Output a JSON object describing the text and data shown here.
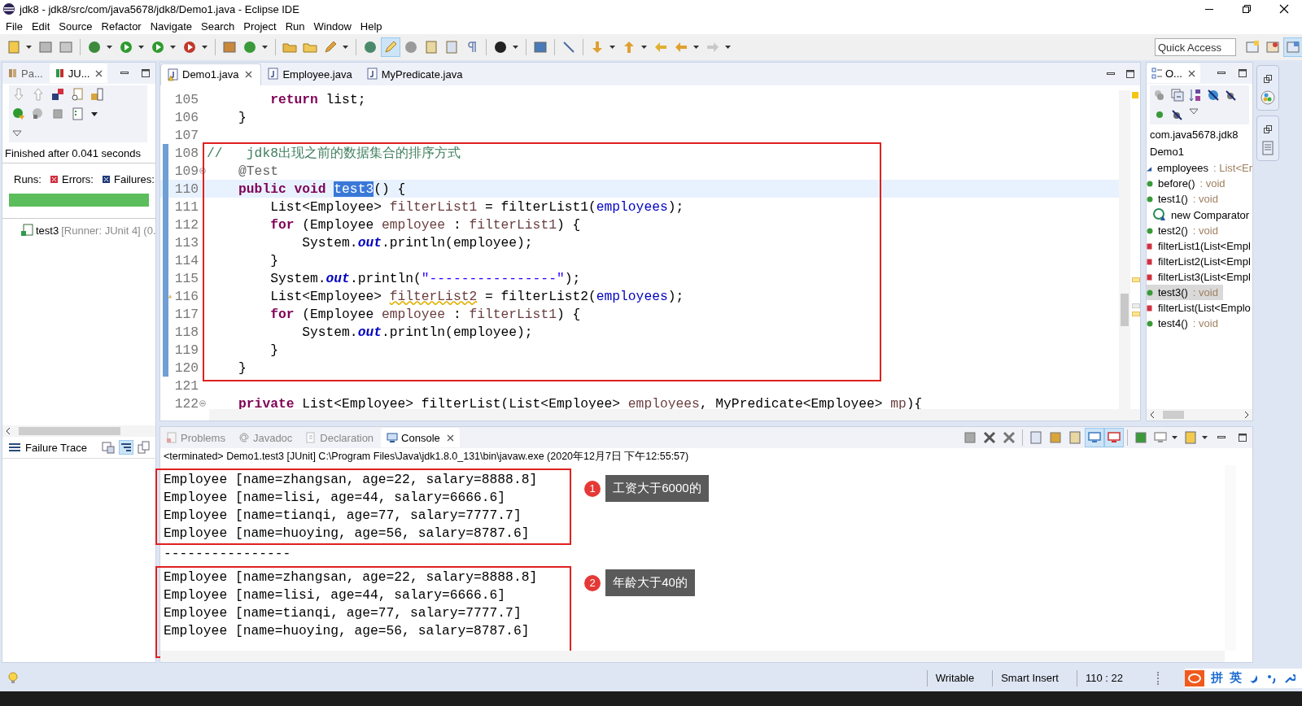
{
  "window": {
    "title": "jdk8 - jdk8/src/com/java5678/jdk8/Demo1.java - Eclipse IDE"
  },
  "menu": [
    "File",
    "Edit",
    "Source",
    "Refactor",
    "Navigate",
    "Search",
    "Project",
    "Run",
    "Window",
    "Help"
  ],
  "quick_access": {
    "placeholder": "Quick Access"
  },
  "junit": {
    "tabs": [
      {
        "label": "Pa...",
        "selected": false
      },
      {
        "label": "JU...",
        "selected": true
      }
    ],
    "status": "Finished after 0.041 seconds",
    "runs": "Runs:",
    "errors": "Errors:",
    "failures": "Failures:",
    "level": 1,
    "tree": [
      {
        "name": "test3",
        "detail": "[Runner: JUnit 4] (0."
      }
    ],
    "failure_trace": "Failure Trace"
  },
  "editor": {
    "tabs": [
      {
        "label": "Demo1.java",
        "selected": true,
        "warning": true
      },
      {
        "label": "Employee.java",
        "selected": false,
        "warning": false
      },
      {
        "label": "MyPredicate.java",
        "selected": false,
        "warning": false
      }
    ],
    "blocks": [
      {
        "boxed": false,
        "lines": [
          {
            "number": "105",
            "changed": false,
            "current": false,
            "fold": false,
            "warning": false,
            "tokens": [
              {
                "text": "        return",
                "kind": "keyword"
              },
              {
                "text": " list;",
                "kind": "plain"
              }
            ]
          },
          {
            "number": "106",
            "changed": false,
            "current": false,
            "fold": false,
            "warning": false,
            "tokens": [
              {
                "text": "    }",
                "kind": "plain"
              }
            ]
          },
          {
            "number": "107",
            "changed": false,
            "current": false,
            "fold": false,
            "warning": false
          }
        ]
      },
      {
        "boxed": true,
        "lines": [
          {
            "number": "108",
            "changed": true,
            "current": false,
            "fold": false,
            "warning": false,
            "tokens": [
              {
                "text": "//   jdk8出现之前的数据集合的排序方式",
                "kind": "comment"
              }
            ]
          },
          {
            "number": "109",
            "changed": true,
            "current": false,
            "fold": true,
            "warning": false,
            "tokens": [
              {
                "text": "    @Test",
                "kind": "annotation"
              }
            ]
          },
          {
            "number": "110",
            "changed": true,
            "current": true,
            "fold": false,
            "warning": false,
            "tokens": [
              {
                "text": "    public void ",
                "kind": "keyword"
              },
              {
                "text": "test3",
                "kind": "selection"
              },
              {
                "text": "() {",
                "kind": "plain"
              }
            ]
          },
          {
            "number": "111",
            "changed": true,
            "current": false,
            "fold": false,
            "warning": false,
            "tokens": [
              {
                "text": "        List<Employee> ",
                "kind": "plain"
              },
              {
                "text": "filterList1",
                "kind": "local"
              },
              {
                "text": " = filterList1(",
                "kind": "plain"
              },
              {
                "text": "employees",
                "kind": "field"
              },
              {
                "text": ");",
                "kind": "plain"
              }
            ]
          },
          {
            "number": "112",
            "changed": true,
            "current": false,
            "fold": false,
            "warning": false,
            "tokens": [
              {
                "text": "        for",
                "kind": "keyword"
              },
              {
                "text": " (Employee ",
                "kind": "plain"
              },
              {
                "text": "employee",
                "kind": "local"
              },
              {
                "text": " : ",
                "kind": "plain"
              },
              {
                "text": "filterList1",
                "kind": "local"
              },
              {
                "text": ") {",
                "kind": "plain"
              }
            ]
          },
          {
            "number": "113",
            "changed": true,
            "current": false,
            "fold": false,
            "warning": false,
            "tokens": [
              {
                "text": "            System.",
                "kind": "plain"
              },
              {
                "text": "out",
                "kind": "static"
              },
              {
                "text": ".println(employee);",
                "kind": "plain"
              }
            ]
          },
          {
            "number": "114",
            "changed": true,
            "current": false,
            "fold": false,
            "warning": false,
            "tokens": [
              {
                "text": "        }",
                "kind": "plain"
              }
            ]
          },
          {
            "number": "115",
            "changed": true,
            "current": false,
            "fold": false,
            "warning": false,
            "tokens": [
              {
                "text": "        System.",
                "kind": "plain"
              },
              {
                "text": "out",
                "kind": "static"
              },
              {
                "text": ".println(",
                "kind": "plain"
              },
              {
                "text": "\"----------------\"",
                "kind": "string"
              },
              {
                "text": ");",
                "kind": "plain"
              }
            ]
          },
          {
            "number": "116",
            "changed": true,
            "current": false,
            "fold": false,
            "warning": true,
            "tokens": [
              {
                "text": "        List<Employee> ",
                "kind": "plain"
              },
              {
                "text": "filterList2",
                "kind": "unused"
              },
              {
                "text": " = filterList2(",
                "kind": "plain"
              },
              {
                "text": "employees",
                "kind": "field"
              },
              {
                "text": ");",
                "kind": "plain"
              }
            ]
          },
          {
            "number": "117",
            "changed": true,
            "current": false,
            "fold": false,
            "warning": false,
            "tokens": [
              {
                "text": "        for",
                "kind": "keyword"
              },
              {
                "text": " (Employee ",
                "kind": "plain"
              },
              {
                "text": "employee",
                "kind": "local"
              },
              {
                "text": " : ",
                "kind": "plain"
              },
              {
                "text": "filterList1",
                "kind": "local"
              },
              {
                "text": ") {",
                "kind": "plain"
              }
            ]
          },
          {
            "number": "118",
            "changed": true,
            "current": false,
            "fold": false,
            "warning": false,
            "tokens": [
              {
                "text": "            System.",
                "kind": "plain"
              },
              {
                "text": "out",
                "kind": "static"
              },
              {
                "text": ".println(employee);",
                "kind": "plain"
              }
            ]
          },
          {
            "number": "119",
            "changed": true,
            "current": false,
            "fold": false,
            "warning": false,
            "tokens": [
              {
                "text": "        }",
                "kind": "plain"
              }
            ]
          },
          {
            "number": "120",
            "changed": true,
            "current": false,
            "fold": false,
            "warning": false,
            "tokens": [
              {
                "text": "    }",
                "kind": "plain"
              }
            ]
          }
        ]
      },
      {
        "boxed": false,
        "lines": [
          {
            "number": "121",
            "changed": false,
            "current": false,
            "fold": false,
            "warning": false
          },
          {
            "number": "122",
            "changed": false,
            "current": false,
            "fold": true,
            "warning": false,
            "tokens": [
              {
                "text": "    private",
                "kind": "keyword"
              },
              {
                "text": " List<Employee> filterList(List<Employee> ",
                "kind": "plain"
              },
              {
                "text": "employees",
                "kind": "local"
              },
              {
                "text": ", MyPredicate<Employee> ",
                "kind": "plain"
              },
              {
                "text": "mp",
                "kind": "local"
              },
              {
                "text": "){",
                "kind": "plain"
              }
            ]
          }
        ]
      }
    ]
  },
  "outline": {
    "tab": "O...",
    "package": "com.java5678.jdk8",
    "class": "Demo1",
    "items": [
      {
        "kind": "field",
        "name": "employees",
        "type": ": List<Er",
        "selected": false
      },
      {
        "kind": "public",
        "name": "before()",
        "type": ": void",
        "selected": false
      },
      {
        "kind": "public",
        "name": "test1()",
        "type": ": void",
        "selected": false,
        "children": [
          {
            "kind": "anon",
            "name": "new Comparator",
            "selected": false
          }
        ]
      },
      {
        "kind": "public",
        "name": "test2()",
        "type": ": void",
        "selected": false
      },
      {
        "kind": "private",
        "name": "filterList1(List<Empl",
        "selected": false
      },
      {
        "kind": "private",
        "name": "filterList2(List<Empl",
        "selected": false
      },
      {
        "kind": "private",
        "name": "filterList3(List<Empl",
        "selected": false
      },
      {
        "kind": "public",
        "name": "test3()",
        "type": ": void",
        "selected": true
      },
      {
        "kind": "private",
        "name": "filterList(List<Emplo",
        "selected": false
      },
      {
        "kind": "public",
        "name": "test4()",
        "type": ": void",
        "selected": false
      }
    ]
  },
  "console": {
    "tabs": [
      {
        "label": "Problems",
        "selected": false
      },
      {
        "label": "Javadoc",
        "selected": false
      },
      {
        "label": "Declaration",
        "selected": false
      },
      {
        "label": "Console",
        "selected": true
      }
    ],
    "header": "<terminated> Demo1.test3 [JUnit] C:\\Program Files\\Java\\jdk1.8.0_131\\bin\\javaw.exe (2020年12月7日 下午12:55:57)",
    "blocks": [
      {
        "kind": "group",
        "lines": [
          "Employee [name=zhangsan, age=22, salary=8888.8]",
          "Employee [name=lisi, age=44, salary=6666.6]",
          "Employee [name=tianqi, age=77, salary=7777.7]",
          "Employee [name=huoying, age=56, salary=8787.6]"
        ],
        "note": {
          "number": "1",
          "text": "工资大于6000的"
        }
      },
      {
        "kind": "plain",
        "lines": [
          "----------------"
        ]
      },
      {
        "kind": "group",
        "lines": [
          "Employee [name=zhangsan, age=22, salary=8888.8]",
          "Employee [name=lisi, age=44, salary=6666.6]",
          "Employee [name=tianqi, age=77, salary=7777.7]",
          "Employee [name=huoying, age=56, salary=8787.6]"
        ],
        "note": {
          "number": "2",
          "text": "年龄大于40的"
        }
      }
    ]
  },
  "status_bar": {
    "items": [
      "Writable",
      "Smart Insert",
      "110 : 22"
    ],
    "ime": [
      "拼",
      "英"
    ]
  }
}
